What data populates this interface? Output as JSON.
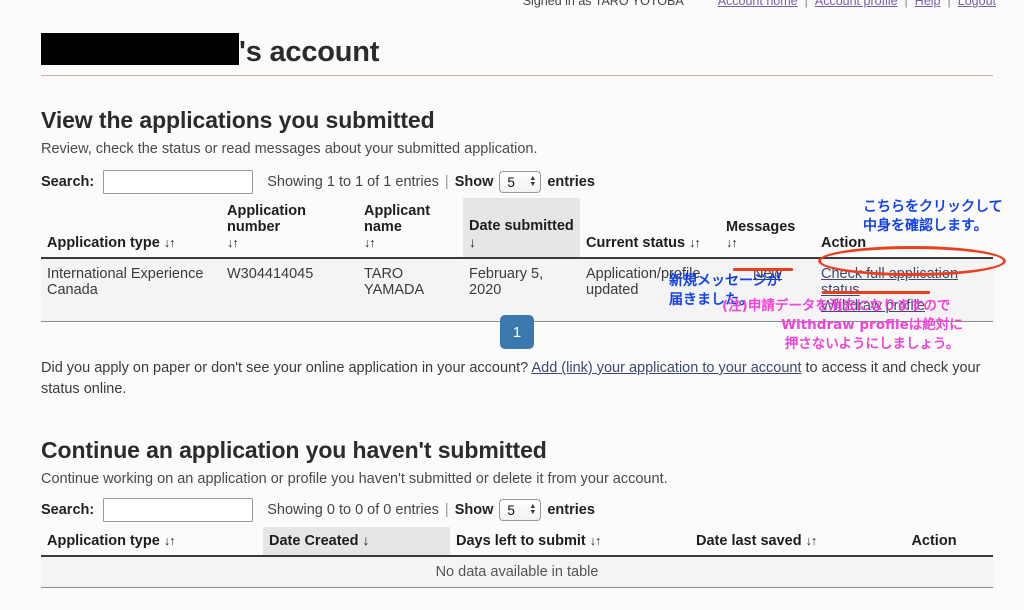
{
  "topbar": {
    "signed_in_as": "Signed in as TARO YOTOBA",
    "links": [
      "Account home",
      "Account profile",
      "Help",
      "Logout"
    ],
    "separator": "|"
  },
  "header": {
    "redacted_name": "",
    "title_suffix": "'s account"
  },
  "submitted_section": {
    "heading": "View the applications you submitted",
    "subheading": "Review, check the status or read messages about your submitted application.",
    "search_label": "Search:",
    "search_value": "",
    "search_placeholder": "",
    "showing_text": "Showing 1 to 1 of 1 entries",
    "show_label": "Show",
    "show_value": "5",
    "entries_label": "entries",
    "columns": [
      {
        "label": "Application type",
        "sort": "both"
      },
      {
        "label": "Application number",
        "sort": "both"
      },
      {
        "label": "Applicant name",
        "sort": "both"
      },
      {
        "label": "Date submitted",
        "sort": "desc"
      },
      {
        "label": "Current status",
        "sort": "both"
      },
      {
        "label": "Messages",
        "sort": "both"
      },
      {
        "label": "Action",
        "sort": "none"
      }
    ],
    "rows": [
      {
        "application_type": "International Experience Canada",
        "application_number": "W304414045",
        "applicant_name": "TARO YAMADA",
        "date_submitted": "February 5, 2020",
        "current_status": "Application/profile updated",
        "messages": "New",
        "action_primary": "Check full application status",
        "action_secondary": "Withdraw profile"
      }
    ],
    "pagination": {
      "current_page": "1"
    },
    "footer_text_before": "Did you apply on paper or don't see your online application in your account?",
    "footer_link": "Add (link) your application to your account",
    "footer_text_after": "to access it and check your status online."
  },
  "continue_section": {
    "heading": "Continue an application you haven't submitted",
    "subheading": "Continue working on an application or profile you haven't submitted or delete it from your account.",
    "search_label": "Search:",
    "search_value": "",
    "search_placeholder": "",
    "showing_text": "Showing 0 to 0 of 0 entries",
    "show_label": "Show",
    "show_value": "5",
    "entries_label": "entries",
    "columns": [
      {
        "label": "Application type",
        "sort": "both"
      },
      {
        "label": "Date Created",
        "sort": "desc"
      },
      {
        "label": "Days left to submit",
        "sort": "both"
      },
      {
        "label": "Date last saved",
        "sort": "both"
      },
      {
        "label": "Action",
        "sort": "none"
      }
    ],
    "empty_text": "No data available in table"
  },
  "annotations": {
    "blue_action_note": "こちらをクリックして\n中身を確認します。",
    "blue_action_note_line1": "こちらをクリックして",
    "blue_action_note_line2": "中身を確認します。",
    "blue_message_note_line1": "新規メッセージが",
    "blue_message_note_line2": "届きました。",
    "pink_warning_line1": "(注)申請データを消去になりますので",
    "pink_warning_line2": "Withdraw profileは絶対に",
    "pink_warning_line3": "押さないようにしましょう。",
    "colors": {
      "blue": "#1442e8",
      "pink": "#ef44d8",
      "red": "#e8401f",
      "link": "#3c4a6b",
      "pager": "#3b78ad"
    }
  },
  "sort_glyphs": {
    "both": "↓↑",
    "desc": "↓"
  }
}
